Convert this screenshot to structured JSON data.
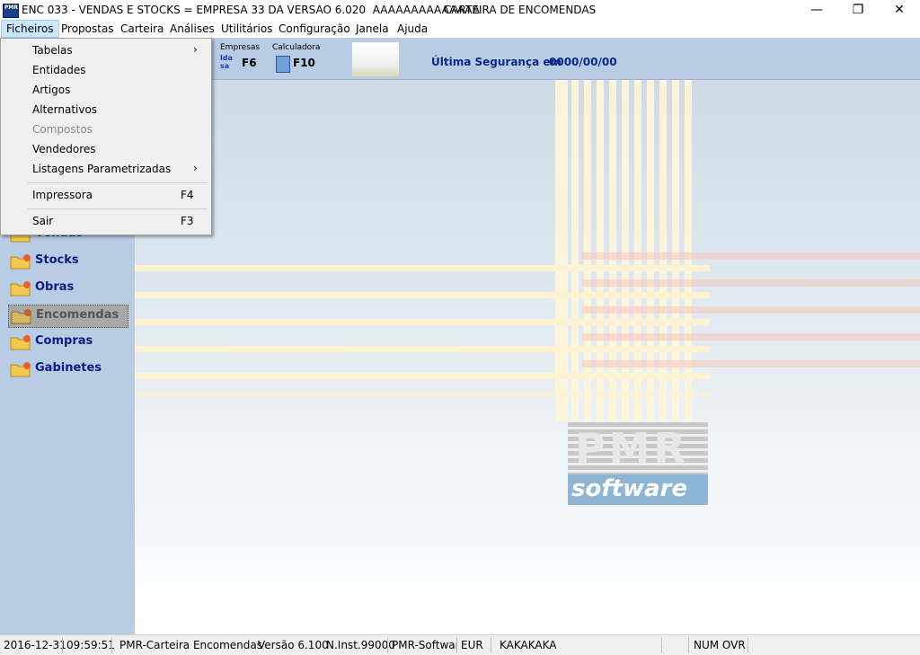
{
  "titlebar": {
    "title": "ENC 033 - VENDAS E STOCKS = EMPRESA 33 DA VERSAO 6.020  AAAAAAAAAAAAAA",
    "subtitle": "CARTEIRA DE ENCOMENDAS",
    "app_icon_text": "PMR",
    "minimize_icon": "—",
    "restore_icon": "❐",
    "close_icon": "✕"
  },
  "menubar": [
    "Ficheiros",
    "Propostas",
    "Carteira",
    "Análises",
    "Utilitários",
    "Configuração",
    "Janela",
    "Ajuda"
  ],
  "toolbar": {
    "empresas_label": "Empresas",
    "empresas_key": "F6",
    "empresas_icon_text": "lda sa",
    "calculadora_label": "Calculadora",
    "calculadora_key": "F10",
    "seguranca_label": "Última Segurança em",
    "seguranca_value": "0000/00/00"
  },
  "dropdown": {
    "items": [
      {
        "label": "Tabelas",
        "arrow": "›"
      },
      {
        "label": "Entidades"
      },
      {
        "label": "Artigos"
      },
      {
        "label": "Alternativos"
      },
      {
        "label": "Compostos",
        "disabled": true
      },
      {
        "label": "Vendedores"
      },
      {
        "label": "Listagens Parametrizadas",
        "arrow": "›"
      },
      {
        "label": "Impressora",
        "shortcut": "F4"
      },
      {
        "label": "Sair",
        "shortcut": "F3"
      }
    ]
  },
  "sidebar": {
    "items": [
      "Vendas",
      "Stocks",
      "Obras",
      "Encomendas",
      "Compras",
      "Gabinetes"
    ],
    "selected": "Encomendas"
  },
  "logo": {
    "top": "PMR",
    "bottom": "software"
  },
  "statusbar": {
    "date": "2016-12-31",
    "time": "09:59:51",
    "app": "PMR-Carteira Encomendas",
    "version": "Versão  6.100",
    "inst": "N.Inst.99000",
    "company": "PMR-Software",
    "currency": "EUR",
    "user": "KAKAKAKA",
    "flags": "NUM OVR"
  },
  "colors": {
    "accent": "#0a1e8a",
    "sidebar_bg": "#b8cde4",
    "menu_highlight": "#cce8ff"
  }
}
